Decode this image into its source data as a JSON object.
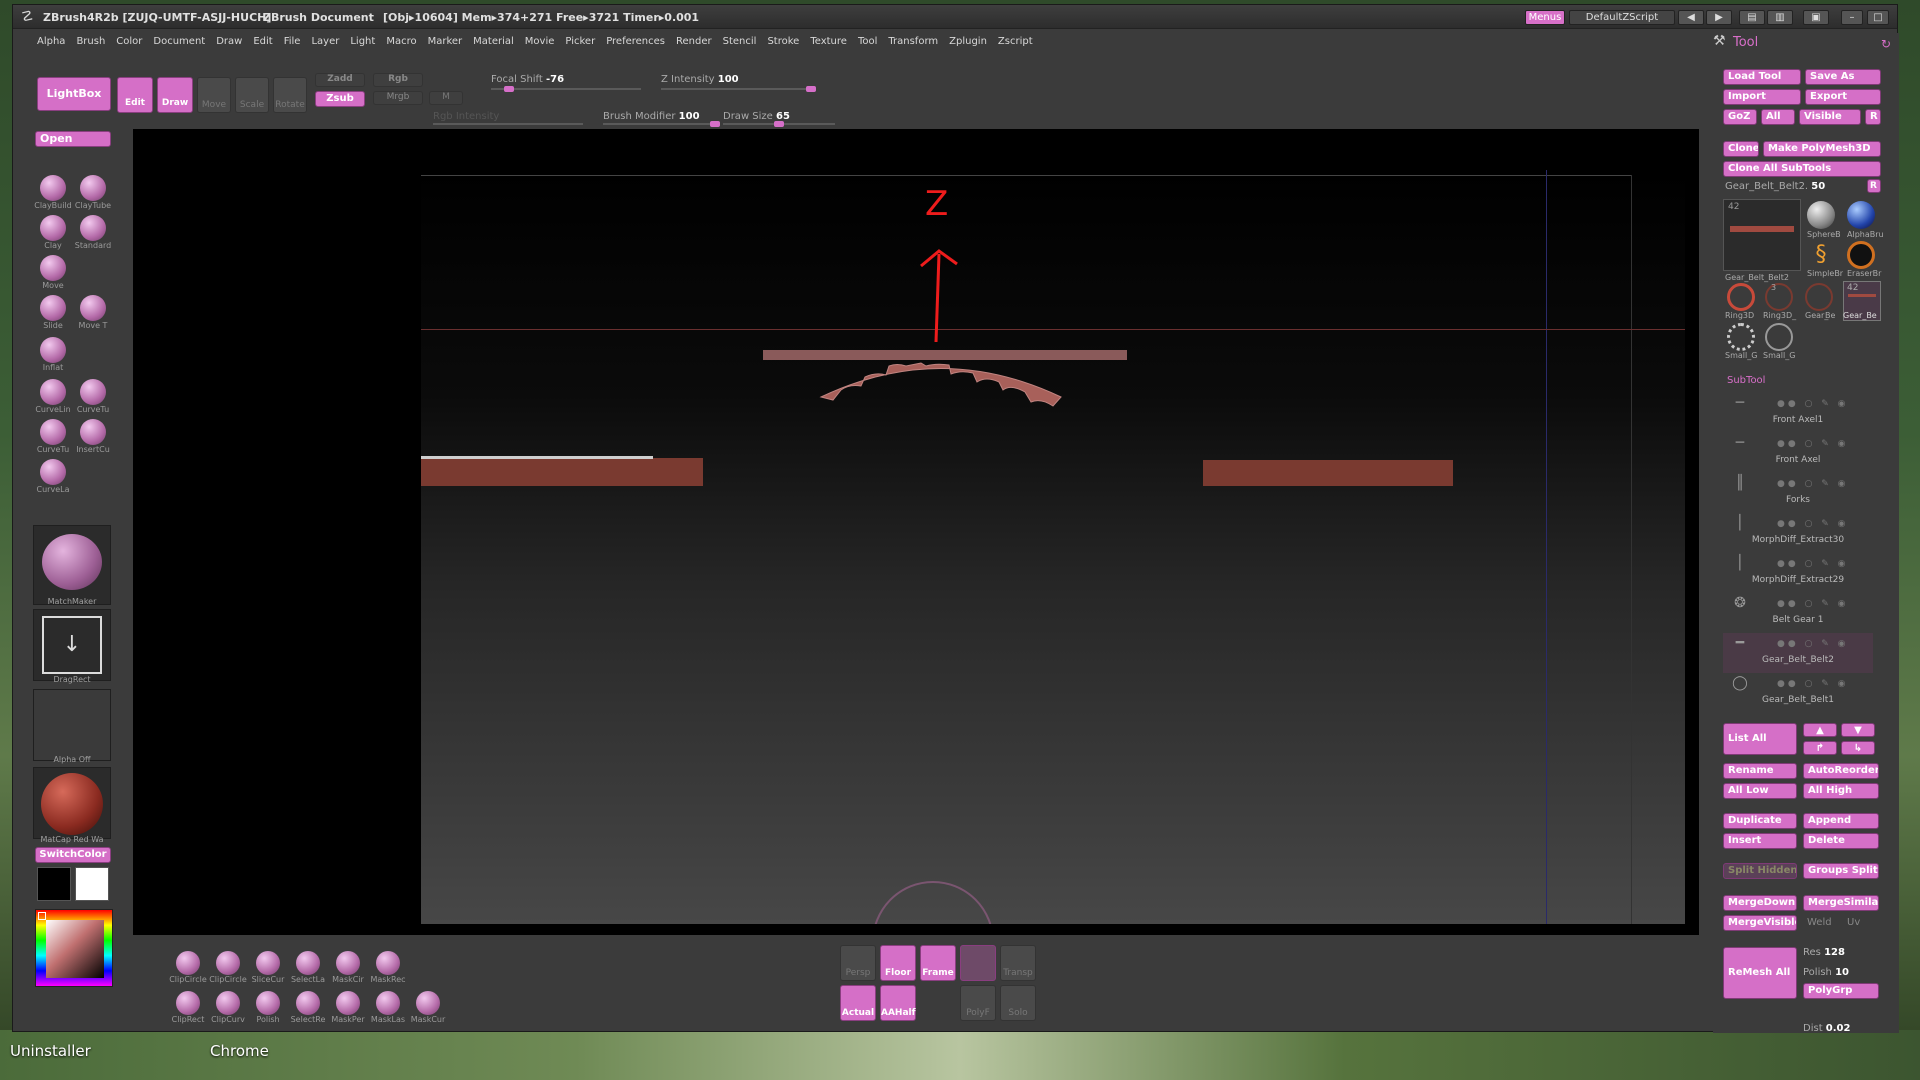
{
  "desktop": {
    "labels": [
      "Uninstaller",
      "Chrome"
    ]
  },
  "window": {
    "title": "ZBrush4R2b [ZUJQ-UMTF-ASJJ-HUCH]",
    "document": "ZBrush Document",
    "stats": "[Obj▸10604] Mem▸374+271 Free▸3721 Timer▸0.001",
    "menus_btn": "Menus",
    "script": "DefaultZScript"
  },
  "menubar": [
    "Alpha",
    "Brush",
    "Color",
    "Document",
    "Draw",
    "Edit",
    "File",
    "Layer",
    "Light",
    "Macro",
    "Marker",
    "Material",
    "Movie",
    "Picker",
    "Preferences",
    "Render",
    "Stencil",
    "Stroke",
    "Texture",
    "Tool",
    "Transform",
    "Zplugin",
    "Zscript"
  ],
  "top": {
    "lightbox": "LightBox",
    "edit": "Edit",
    "draw": "Draw",
    "move": "Move",
    "scale": "Scale",
    "rotate": "Rotate",
    "zadd": "Zadd",
    "zsub": "Zsub",
    "rgb": "Rgb",
    "mrgb": "Mrgb",
    "m": "M",
    "focal_label": "Focal Shift",
    "focal_value": "-76",
    "zint_label": "Z Intensity",
    "zint_value": "100",
    "rgbint_label": "Rgb Intensity",
    "bmod_label": "Brush Modifier",
    "bmod_value": "100",
    "dsize_label": "Draw Size",
    "dsize_value": "65",
    "focal_frac": 0.12,
    "zint_frac": 1.0,
    "bmod_frac": 1.0,
    "dsize_frac": 0.5
  },
  "left": {
    "open": "Open",
    "brushes": [
      "ClayBuild",
      "ClayTube",
      "Clay",
      "Standard",
      "Move",
      "Slide",
      "Move T",
      "Inflat",
      "CurveLin",
      "CurveTu",
      "CurveTu",
      "InsertCu",
      "CurveLa"
    ],
    "matchmaker": "MatchMaker",
    "dragrect": "DragRect",
    "alpha": "Alpha Off",
    "matcap": "MatCap Red Wa",
    "switchcolor": "SwitchColor"
  },
  "viewport": {
    "axis_label": "Z"
  },
  "bottom": {
    "tools": [
      "ClipCircle",
      "ClipCircle",
      "SliceCur",
      "SelectLa",
      "MaskCir",
      "MaskRec",
      "ClipRect",
      "ClipCurv",
      "Polish",
      "SelectRe",
      "MaskPer",
      "MaskLas",
      "MaskCur"
    ],
    "view": [
      "Persp",
      "Floor",
      "Frame",
      "",
      "Transp",
      "Actual",
      "AAHalf",
      "PolyF",
      "Solo"
    ]
  },
  "right": {
    "header": "Tool",
    "load_tool": "Load Tool",
    "save_as": "Save As",
    "import": "Import",
    "export": "Export",
    "goz": "GoZ",
    "all": "All",
    "visible": "Visible",
    "r": "R",
    "clone": "Clone",
    "make_polymesh": "Make PolyMesh3D",
    "clone_all": "Clone All SubTools",
    "current_tool": "Gear_Belt_Belt2.",
    "current_num": "50",
    "thumb_count": "42",
    "thumbs": [
      "Gear_Belt_Belt2",
      "SphereB",
      "AlphaBru",
      "SimpleBr",
      "EraserBr",
      "Ring3D",
      "Ring3D_",
      "Gear_",
      "Be",
      "Gear_Be",
      "Small_G",
      "Small_G"
    ],
    "thumb_count2": "3",
    "subtool_header": "SubTool",
    "subtools": [
      "Front Axel1",
      "Front Axel",
      "Forks",
      "MorphDiff_Extract30",
      "MorphDiff_Extract29",
      "Belt Gear 1",
      "Gear_Belt_Belt2",
      "Gear_Belt_Belt1"
    ],
    "list_all": "List All",
    "rename": "Rename",
    "autoreorder": "AutoReorder",
    "all_low": "All Low",
    "all_high": "All High",
    "duplicate": "Duplicate",
    "append": "Append",
    "insert": "Insert",
    "delete": "Delete",
    "split_hidden": "Split Hidden",
    "groups_split": "Groups Split",
    "mergedown": "MergeDown",
    "mergesimilar": "MergeSimilar",
    "mergevisible": "MergeVisible",
    "weld": "Weld",
    "uv": "Uv",
    "remesh_all": "ReMesh All",
    "res_label": "Res",
    "res_value": "128",
    "polish_label": "Polish",
    "polish_value": "10",
    "polygrp": "PolyGrp",
    "dist_label": "Dist",
    "dist_value": "0.02"
  },
  "colors": {
    "accent": "#d56fc7",
    "mesh": "#8a3f3a"
  }
}
